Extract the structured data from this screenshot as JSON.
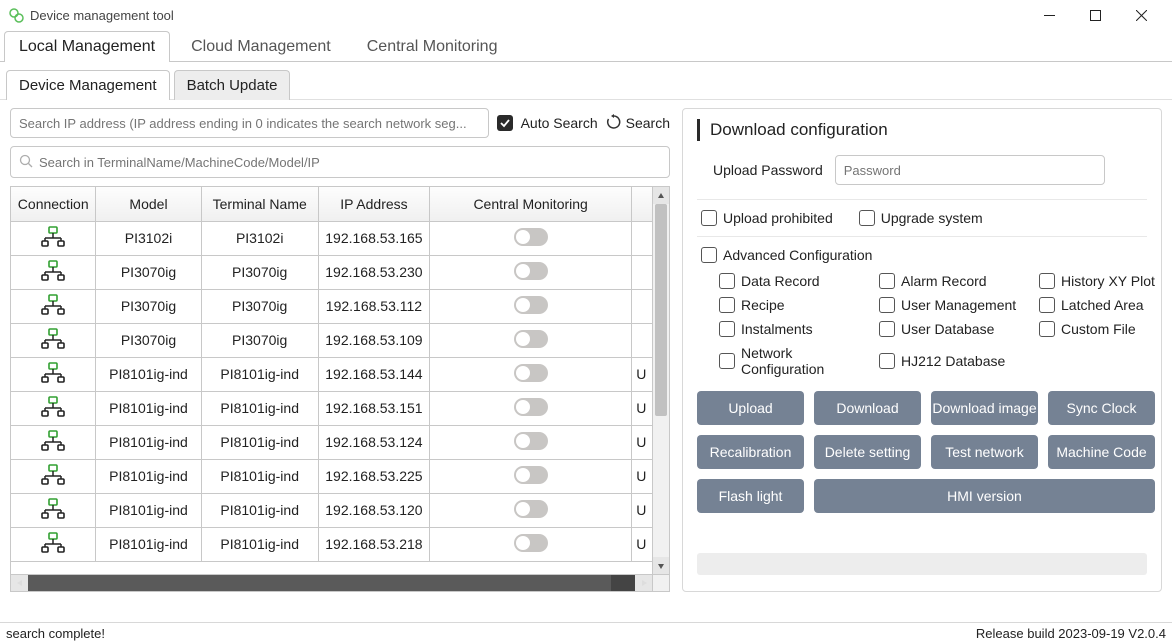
{
  "window": {
    "title": "Device management tool"
  },
  "main_tabs": [
    "Local Management",
    "Cloud Management",
    "Central Monitoring"
  ],
  "sub_tabs": [
    "Device Management",
    "Batch Update"
  ],
  "search_ip_placeholder": "Search IP address (IP address ending in 0 indicates the search network seg...",
  "auto_search_label": "Auto Search",
  "search_btn_label": "Search",
  "filter_placeholder": "Search in TerminalName/MachineCode/Model/IP",
  "table": {
    "headers": [
      "Connection",
      "Model",
      "Terminal Name",
      "IP Address",
      "Central Monitoring",
      ""
    ],
    "rows": [
      {
        "model": "PI3102i",
        "terminal": "PI3102i",
        "ip": "192.168.53.165",
        "last": ""
      },
      {
        "model": "PI3070ig",
        "terminal": "PI3070ig",
        "ip": "192.168.53.230",
        "last": ""
      },
      {
        "model": "PI3070ig",
        "terminal": "PI3070ig",
        "ip": "192.168.53.112",
        "last": ""
      },
      {
        "model": "PI3070ig",
        "terminal": "PI3070ig",
        "ip": "192.168.53.109",
        "last": ""
      },
      {
        "model": "PI8101ig-ind",
        "terminal": "PI8101ig-ind",
        "ip": "192.168.53.144",
        "last": "U"
      },
      {
        "model": "PI8101ig-ind",
        "terminal": "PI8101ig-ind",
        "ip": "192.168.53.151",
        "last": "U"
      },
      {
        "model": "PI8101ig-ind",
        "terminal": "PI8101ig-ind",
        "ip": "192.168.53.124",
        "last": "U"
      },
      {
        "model": "PI8101ig-ind",
        "terminal": "PI8101ig-ind",
        "ip": "192.168.53.225",
        "last": "U"
      },
      {
        "model": "PI8101ig-ind",
        "terminal": "PI8101ig-ind",
        "ip": "192.168.53.120",
        "last": "U"
      },
      {
        "model": "PI8101ig-ind",
        "terminal": "PI8101ig-ind",
        "ip": "192.168.53.218",
        "last": "U"
      }
    ]
  },
  "right": {
    "title": "Download configuration",
    "upload_pw_label": "Upload Password",
    "upload_pw_placeholder": "Password",
    "upload_prohibited": "Upload prohibited",
    "upgrade_system": "Upgrade system",
    "advanced_label": "Advanced Configuration",
    "adv_items": [
      "Data Record",
      "Alarm Record",
      "History XY Plot",
      "Recipe",
      "User Management",
      "Latched Area",
      "Instalments",
      "User Database",
      "Custom File",
      "Network Configuration",
      "HJ212 Database"
    ],
    "buttons": [
      "Upload",
      "Download",
      "Download image",
      "Sync Clock",
      "Recalibration",
      "Delete setting",
      "Test network",
      "Machine Code",
      "Flash light",
      "HMI version"
    ]
  },
  "status": {
    "left": "search complete!",
    "right": "Release build 2023-09-19 V2.0.4"
  }
}
